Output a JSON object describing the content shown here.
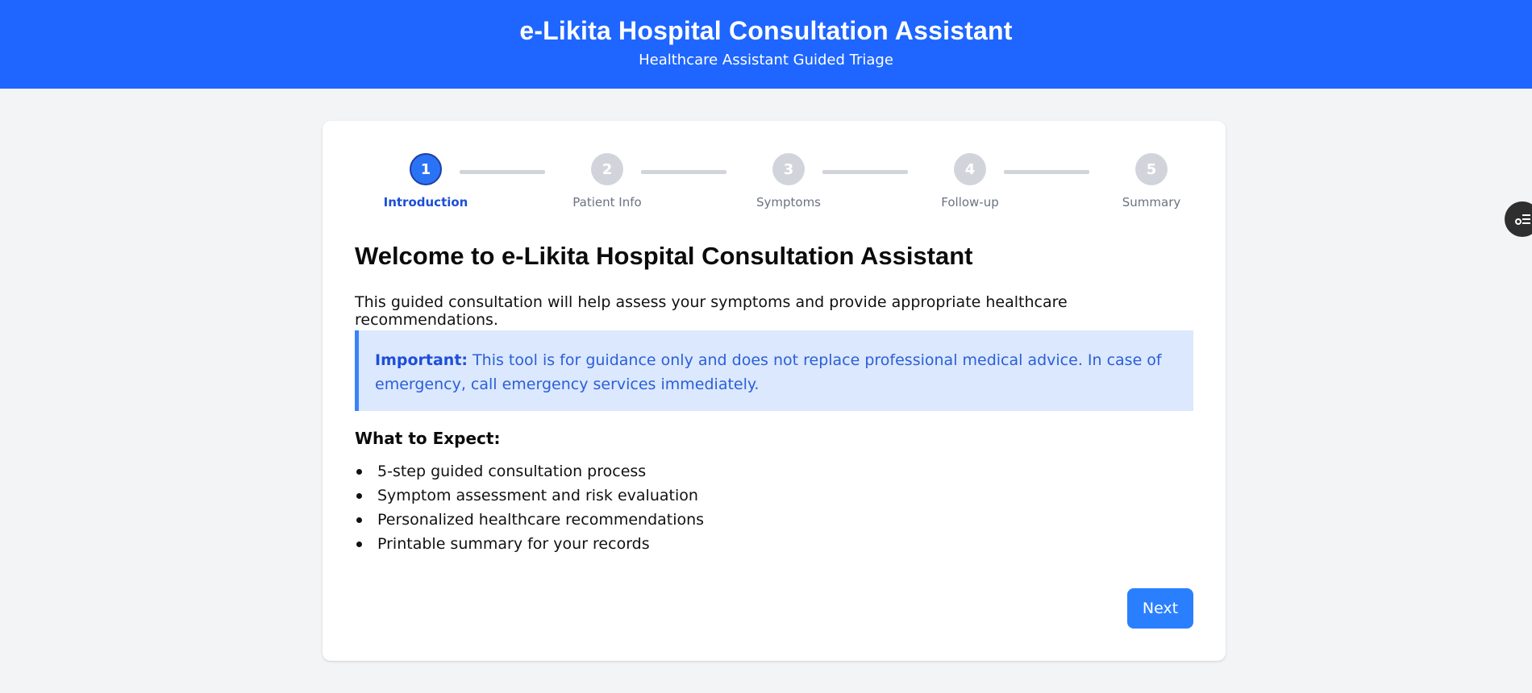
{
  "header": {
    "title": "e-Likita Hospital Consultation Assistant",
    "subtitle": "Healthcare Assistant Guided Triage"
  },
  "stepper": {
    "active_step": 1,
    "steps": [
      {
        "number": "1",
        "label": "Introduction"
      },
      {
        "number": "2",
        "label": "Patient Info"
      },
      {
        "number": "3",
        "label": "Symptoms"
      },
      {
        "number": "4",
        "label": "Follow-up"
      },
      {
        "number": "5",
        "label": "Summary"
      }
    ]
  },
  "main": {
    "heading": "Welcome to e-Likita Hospital Consultation Assistant",
    "intro": "This guided consultation will help assess your symptoms and provide appropriate healthcare recommendations.",
    "notice": {
      "label": "Important:",
      "text": "This tool is for guidance only and does not replace professional medical advice. In case of emergency, call emergency services immediately."
    },
    "expect_heading": "What to Expect:",
    "expect_items": [
      "5-step guided consultation process",
      "Symptom assessment and risk evaluation",
      "Personalized healthcare recommendations",
      "Printable summary for your records"
    ],
    "next_label": "Next"
  },
  "side_widget": {
    "icon": "settings-list-icon"
  },
  "colors": {
    "header_bg": "#1e66ff",
    "accent": "#2a7fff",
    "step_active": "#2a73f5",
    "step_inactive": "#d1d5db",
    "notice_bg": "#dbe8fd",
    "notice_border": "#3b82f6"
  }
}
